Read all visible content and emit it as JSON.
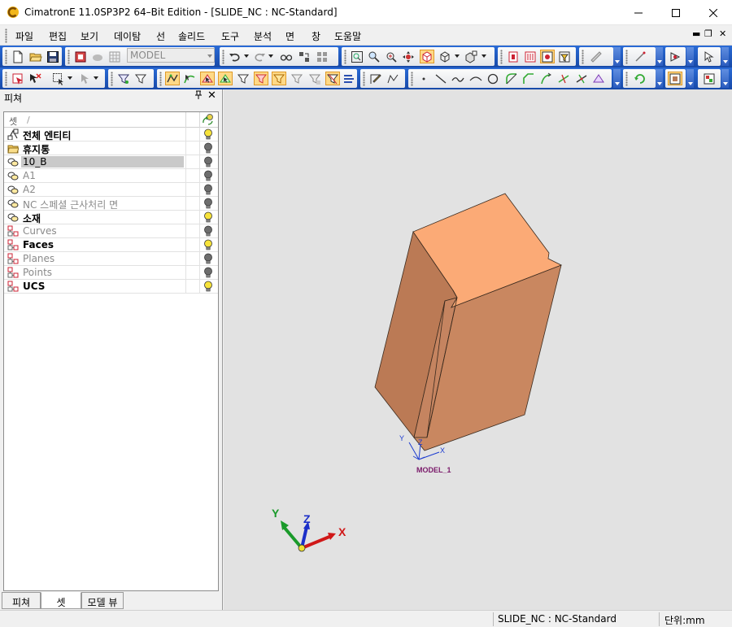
{
  "window": {
    "title": "CimatronE 11.0SP3P2 64–Bit Edition - [SLIDE_NC : NC-Standard]",
    "controls": {
      "minimize": "—",
      "maximize": "☐",
      "close": "✕"
    }
  },
  "menu": {
    "items": [
      "파일",
      "편집",
      "보기",
      "데이탐",
      "선",
      "솔리드",
      "도구",
      "분석",
      "면",
      "창",
      "도움말"
    ],
    "mdi": {
      "minimize": "▬",
      "restore": "❐",
      "close": "✕"
    }
  },
  "toolbar": {
    "model_combo": "MODEL"
  },
  "panel": {
    "title": "피쳐",
    "pin": "ᵖ",
    "close": "✕",
    "list_header": {
      "set": "셋",
      "sort": "/"
    },
    "rows": [
      {
        "label": "전체 엔티티",
        "style": "bold",
        "icon": "all-entities-icon",
        "bulb": "on"
      },
      {
        "label": "휴지통",
        "style": "bold",
        "icon": "trash-folder-icon",
        "bulb": "off"
      },
      {
        "label": "10_B",
        "style": "selected",
        "icon": "set-icon",
        "bulb": "off"
      },
      {
        "label": "A1",
        "style": "gray",
        "icon": "set-icon",
        "bulb": "off"
      },
      {
        "label": "A2",
        "style": "gray",
        "icon": "set-icon",
        "bulb": "off"
      },
      {
        "label": "NC 스페셜 근사처리 면",
        "style": "gray",
        "icon": "set-icon",
        "bulb": "off"
      },
      {
        "label": "소재",
        "style": "bold",
        "icon": "set-icon",
        "bulb": "on"
      },
      {
        "label": "Curves",
        "style": "gray",
        "icon": "tree-set-icon",
        "bulb": "off"
      },
      {
        "label": "Faces",
        "style": "bold",
        "icon": "tree-set-icon",
        "bulb": "on"
      },
      {
        "label": "Planes",
        "style": "gray",
        "icon": "tree-set-icon",
        "bulb": "off"
      },
      {
        "label": "Points",
        "style": "gray",
        "icon": "tree-set-icon",
        "bulb": "off"
      },
      {
        "label": "UCS",
        "style": "bold",
        "icon": "tree-set-icon",
        "bulb": "on"
      }
    ],
    "tabs": [
      "피쳐",
      "셋",
      "모델 뷰"
    ],
    "active_tab": 1
  },
  "viewport": {
    "ucs_label": "MODEL_1",
    "small_axes": {
      "x": "X",
      "y": "Y",
      "z": "Z"
    },
    "triad": {
      "x": "X",
      "y": "Y",
      "z": "Z"
    },
    "colors": {
      "background": "#e2e2e2",
      "part_top": "#fbaa76",
      "part_front": "#c9855f",
      "part_side": "#b77a56",
      "edge": "#3a2a1e"
    }
  },
  "status": {
    "document": "SLIDE_NC : NC-Standard",
    "unit": "단위:mm"
  }
}
